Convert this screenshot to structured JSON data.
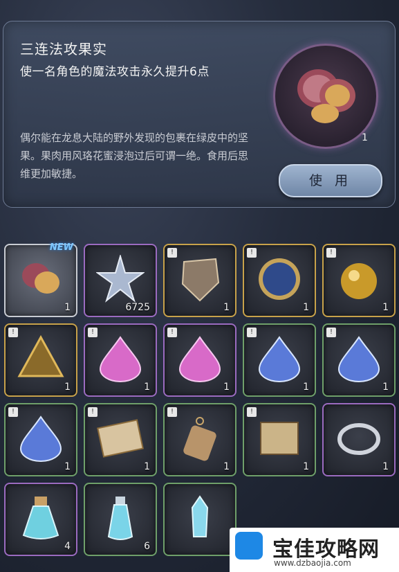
{
  "detail": {
    "title": "三连法攻果实",
    "effect": "使一名角色的魔法攻击永久提升6点",
    "description": "偶尔能在龙息大陆的野外发现的包裹在绿皮中的坚果。果肉用风珞花蜜浸泡过后可谓一绝。食用后思维更加敏捷。",
    "count": "1",
    "use_label": "使 用",
    "icon": "walnut-icon"
  },
  "inventory": [
    {
      "icon": "walnut-icon",
      "count": "1",
      "badge": "NEW",
      "frame": "silver",
      "tag": false
    },
    {
      "icon": "star-crystal-icon",
      "count": "6725",
      "badge": "",
      "frame": "purple",
      "tag": false
    },
    {
      "icon": "stone-shield-icon",
      "count": "1",
      "badge": "",
      "frame": "gold",
      "tag": true
    },
    {
      "icon": "blue-medallion-icon",
      "count": "1",
      "badge": "",
      "frame": "gold",
      "tag": true
    },
    {
      "icon": "gold-orb-icon",
      "count": "1",
      "badge": "",
      "frame": "gold",
      "tag": true
    },
    {
      "icon": "gold-crest-icon",
      "count": "1",
      "badge": "",
      "frame": "gold",
      "tag": true
    },
    {
      "icon": "pink-gem-icon",
      "count": "1",
      "badge": "",
      "frame": "purple",
      "tag": true
    },
    {
      "icon": "pink-gem-icon",
      "count": "1",
      "badge": "",
      "frame": "purple",
      "tag": true
    },
    {
      "icon": "blue-gem-icon",
      "count": "1",
      "badge": "",
      "frame": "green",
      "tag": true
    },
    {
      "icon": "blue-gem-icon",
      "count": "1",
      "badge": "",
      "frame": "green",
      "tag": true
    },
    {
      "icon": "blue-gem-icon",
      "count": "1",
      "badge": "",
      "frame": "green",
      "tag": true
    },
    {
      "icon": "letter-icon",
      "count": "1",
      "badge": "",
      "frame": "green",
      "tag": true
    },
    {
      "icon": "tag-charm-icon",
      "count": "1",
      "badge": "",
      "frame": "green",
      "tag": true
    },
    {
      "icon": "map-scroll-icon",
      "count": "1",
      "badge": "",
      "frame": "green",
      "tag": true
    },
    {
      "icon": "silver-ring-icon",
      "count": "1",
      "badge": "",
      "frame": "purple",
      "tag": false
    },
    {
      "icon": "potion-flask-icon",
      "count": "4",
      "badge": "",
      "frame": "purple",
      "tag": false
    },
    {
      "icon": "potion-bottle-icon",
      "count": "6",
      "badge": "",
      "frame": "green",
      "tag": false
    },
    {
      "icon": "crystal-vial-icon",
      "count": "",
      "badge": "",
      "frame": "green",
      "tag": false
    }
  ],
  "banner": {
    "title": "宝佳攻略网",
    "url": "www.dzbaojia.com"
  },
  "colors": {
    "purple_frame": "#9b6bc0",
    "gold_frame": "#c8a24a",
    "green_frame": "#6fa06a",
    "new_badge": "#7fc8ff"
  }
}
